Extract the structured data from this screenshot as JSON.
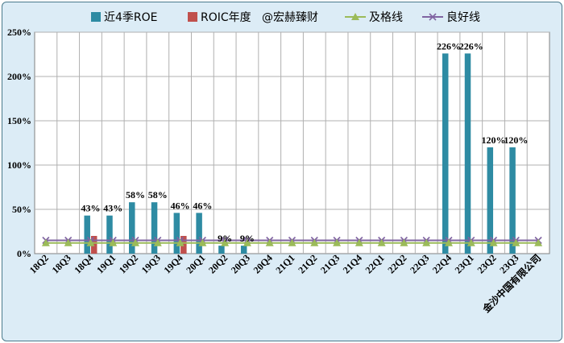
{
  "chart_data": {
    "type": "bar",
    "categories": [
      "18Q2",
      "18Q3",
      "18Q4",
      "19Q1",
      "19Q2",
      "19Q3",
      "19Q4",
      "20Q1",
      "20Q2",
      "20Q3",
      "20Q4",
      "21Q1",
      "21Q2",
      "21Q3",
      "21Q4",
      "22Q1",
      "22Q2",
      "22Q3",
      "22Q4",
      "23Q1",
      "23Q2",
      "23Q3",
      "金沙中国有限公司"
    ],
    "series": [
      {
        "name": "近4季ROE",
        "kind": "bar",
        "color": "#2e8ba3",
        "values": [
          null,
          null,
          43,
          43,
          58,
          58,
          46,
          46,
          9,
          9,
          null,
          null,
          null,
          null,
          null,
          null,
          null,
          null,
          226,
          226,
          120,
          120,
          null
        ],
        "labels": [
          "",
          "",
          "43%",
          "43%",
          "58%",
          "58%",
          "46%",
          "46%",
          "9%",
          "9%",
          "",
          "",
          "",
          "",
          "",
          "",
          "",
          "",
          "226%",
          "226%",
          "120%",
          "120%",
          ""
        ]
      },
      {
        "name": "ROIC年度",
        "kind": "bar",
        "color": "#c0504d",
        "values": [
          null,
          null,
          20,
          null,
          null,
          null,
          20,
          null,
          null,
          null,
          null,
          null,
          null,
          null,
          null,
          null,
          null,
          null,
          null,
          null,
          null,
          null,
          null
        ]
      },
      {
        "name": "@宏赫臻财",
        "kind": "none"
      },
      {
        "name": "及格线",
        "kind": "line",
        "color": "#9bbb59",
        "marker": "triangle",
        "values": [
          12,
          12,
          12,
          12,
          12,
          12,
          12,
          12,
          12,
          12,
          12,
          12,
          12,
          12,
          12,
          12,
          12,
          12,
          12,
          12,
          12,
          12,
          12
        ]
      },
      {
        "name": "良好线",
        "kind": "line",
        "color": "#8064a2",
        "marker": "x",
        "values": [
          15,
          15,
          15,
          15,
          15,
          15,
          15,
          15,
          15,
          15,
          15,
          15,
          15,
          15,
          15,
          15,
          15,
          15,
          15,
          15,
          15,
          15,
          15
        ]
      }
    ],
    "y_ticks": [
      "0%",
      "50%",
      "100%",
      "150%",
      "200%",
      "250%"
    ],
    "ylim": [
      0,
      250
    ],
    "grid": true,
    "legend_position": "top"
  }
}
